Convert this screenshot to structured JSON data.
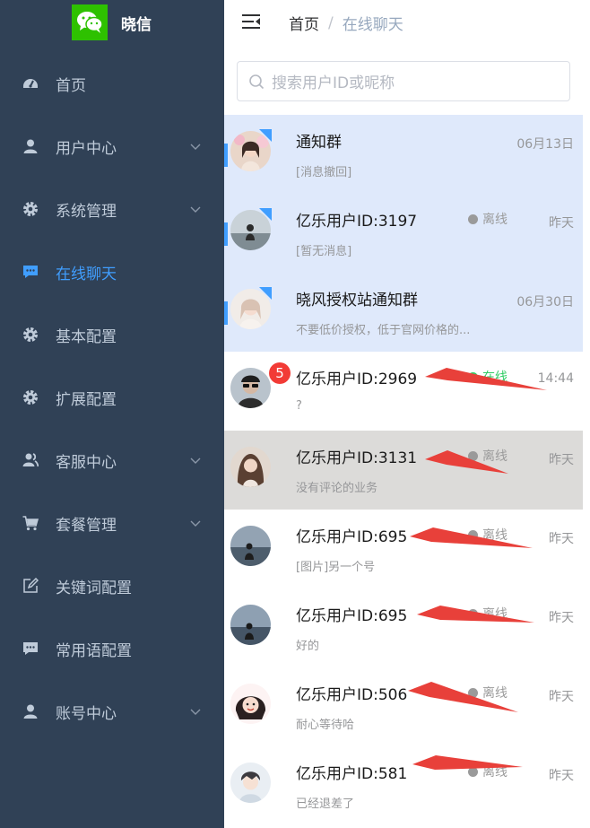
{
  "app": {
    "title": "晓信",
    "logo_color": "#2ec100"
  },
  "sidebar": {
    "bg": "#304156",
    "active_color": "#409eff",
    "items": [
      {
        "label": "首页",
        "icon": "dashboard-icon",
        "arrow": false
      },
      {
        "label": "用户中心",
        "icon": "user-icon",
        "arrow": true
      },
      {
        "label": "系统管理",
        "icon": "gear-icon",
        "arrow": true
      },
      {
        "label": "在线聊天",
        "icon": "chat-bubble-icon",
        "arrow": false,
        "active": true
      },
      {
        "label": "基本配置",
        "icon": "gear-icon",
        "arrow": false
      },
      {
        "label": "扩展配置",
        "icon": "gear-icon",
        "arrow": false
      },
      {
        "label": "客服中心",
        "icon": "users-icon",
        "arrow": true
      },
      {
        "label": "套餐管理",
        "icon": "cart-icon",
        "arrow": true
      },
      {
        "label": "关键词配置",
        "icon": "edit-icon",
        "arrow": false
      },
      {
        "label": "常用语配置",
        "icon": "chat-bubble-icon",
        "arrow": false
      },
      {
        "label": "账号中心",
        "icon": "user-icon",
        "arrow": true
      }
    ]
  },
  "header": {
    "breadcrumb": {
      "home": "首页",
      "separator": "/",
      "current": "在线聊天"
    }
  },
  "search": {
    "placeholder": "搜索用户ID或昵称"
  },
  "chats": [
    {
      "name": "通知群",
      "preview": "[消息撤回]",
      "time": "06月13日",
      "status": "",
      "selected": true,
      "corner": true
    },
    {
      "name": "亿乐用户ID:3197",
      "preview": "[暂无消息]",
      "time": "昨天",
      "status": "离线",
      "selected": true,
      "corner": true
    },
    {
      "name": "晓风授权站通知群",
      "preview": "不要低价授权，低于官网价格的...",
      "time": "06月30日",
      "status": "",
      "selected": true,
      "corner": true
    },
    {
      "name": "亿乐用户ID:2969",
      "preview": "?",
      "time": "14:44",
      "status": "在线",
      "unread": "5"
    },
    {
      "name": "亿乐用户ID:3131",
      "preview": "没有评论的业务",
      "time": "昨天",
      "status": "离线",
      "hover": true
    },
    {
      "name": "亿乐用户ID:695",
      "preview": "[图片]另一个号",
      "time": "昨天",
      "status": "离线"
    },
    {
      "name": "亿乐用户ID:695",
      "preview": "好的",
      "time": "昨天",
      "status": "离线"
    },
    {
      "name": "亿乐用户ID:506",
      "preview": "耐心等待哈",
      "time": "昨天",
      "status": "离线"
    },
    {
      "name": "亿乐用户ID:581",
      "preview": "已经退差了",
      "time": "昨天",
      "status": "离线"
    }
  ],
  "annotation_color": "#e8403a"
}
